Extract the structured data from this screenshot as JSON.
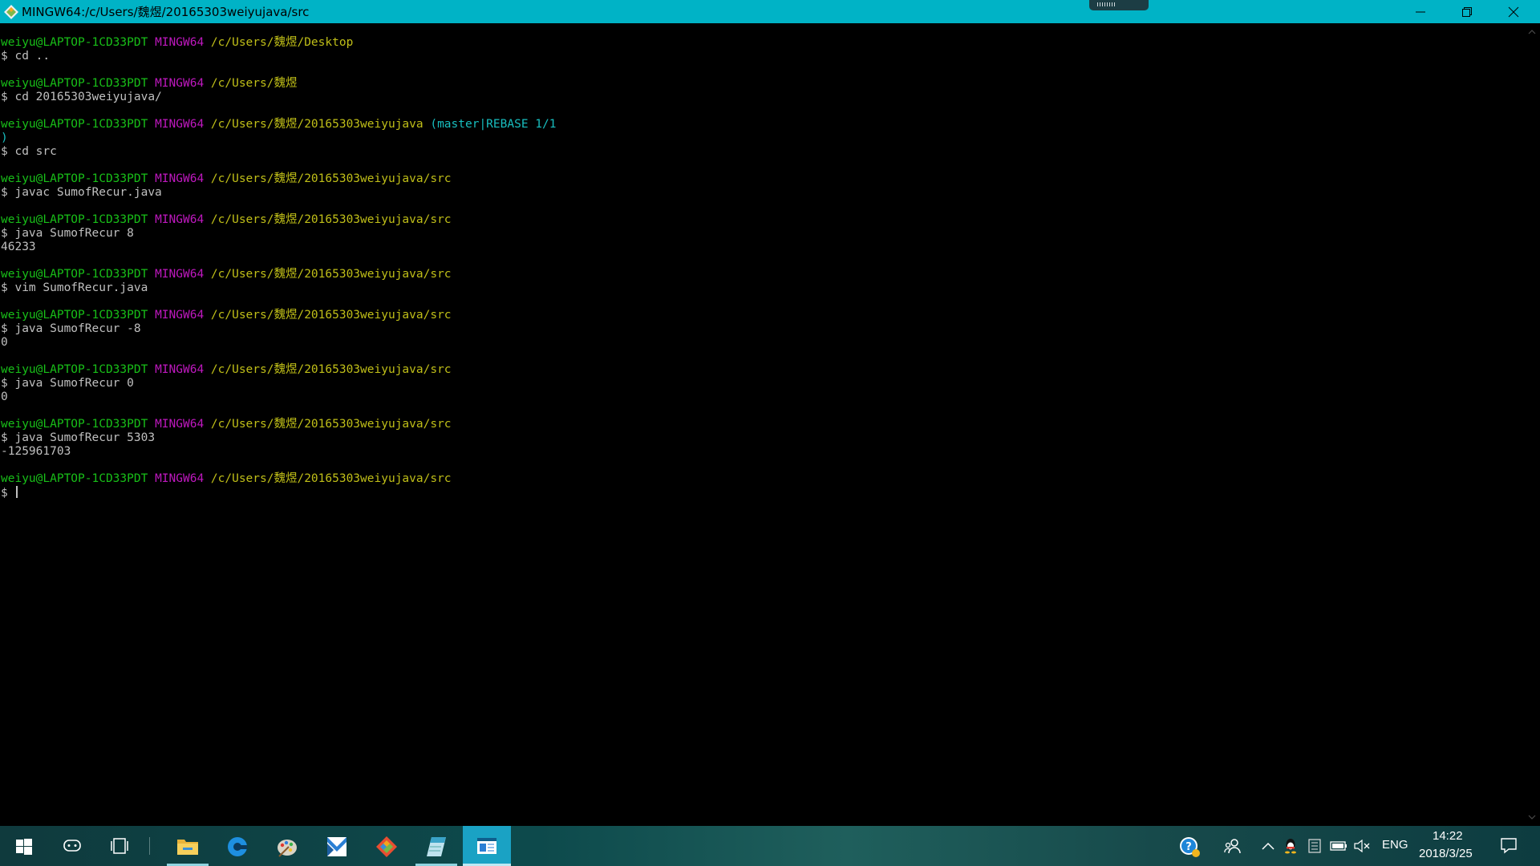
{
  "window": {
    "title": "MINGW64:/c/Users/魏煜/20165303weiyujava/src",
    "app_icon": "git-bash-icon",
    "controls": [
      "minimize-icon",
      "restore-icon",
      "close-icon"
    ]
  },
  "terminal": {
    "colors": {
      "user_host": "#18bf18",
      "msystem": "#bf18bf",
      "path": "#c0bf18",
      "git_branch": "#18bfc0",
      "text": "#c0c0c0"
    },
    "lines": [
      {
        "user": "weiyu@LAPTOP-1CD33PDT",
        "msys": "MINGW64",
        "path": "/c/Users/魏煜/Desktop"
      },
      {
        "cmd": "$ cd .."
      },
      {},
      {
        "user": "weiyu@LAPTOP-1CD33PDT",
        "msys": "MINGW64",
        "path": "/c/Users/魏煜"
      },
      {
        "cmd": "$ cd 20165303weiyujava/"
      },
      {},
      {
        "user": "weiyu@LAPTOP-1CD33PDT",
        "msys": "MINGW64",
        "path": "/c/Users/魏煜/20165303weiyujava",
        "branch": "(master|REBASE 1/1"
      },
      {
        "branch": ")"
      },
      {
        "cmd": "$ cd src"
      },
      {},
      {
        "user": "weiyu@LAPTOP-1CD33PDT",
        "msys": "MINGW64",
        "path": "/c/Users/魏煜/20165303weiyujava/src"
      },
      {
        "cmd": "$ javac SumofRecur.java"
      },
      {},
      {
        "user": "weiyu@LAPTOP-1CD33PDT",
        "msys": "MINGW64",
        "path": "/c/Users/魏煜/20165303weiyujava/src"
      },
      {
        "cmd": "$ java SumofRecur 8"
      },
      {
        "out": "46233"
      },
      {},
      {
        "user": "weiyu@LAPTOP-1CD33PDT",
        "msys": "MINGW64",
        "path": "/c/Users/魏煜/20165303weiyujava/src"
      },
      {
        "cmd": "$ vim SumofRecur.java"
      },
      {},
      {
        "user": "weiyu@LAPTOP-1CD33PDT",
        "msys": "MINGW64",
        "path": "/c/Users/魏煜/20165303weiyujava/src"
      },
      {
        "cmd": "$ java SumofRecur -8"
      },
      {
        "out": "0"
      },
      {},
      {
        "user": "weiyu@LAPTOP-1CD33PDT",
        "msys": "MINGW64",
        "path": "/c/Users/魏煜/20165303weiyujava/src"
      },
      {
        "cmd": "$ java SumofRecur 0"
      },
      {
        "out": "0"
      },
      {},
      {
        "user": "weiyu@LAPTOP-1CD33PDT",
        "msys": "MINGW64",
        "path": "/c/Users/魏煜/20165303weiyujava/src"
      },
      {
        "cmd": "$ java SumofRecur 5303"
      },
      {
        "out": "-125961703"
      },
      {},
      {
        "user": "weiyu@LAPTOP-1CD33PDT",
        "msys": "MINGW64",
        "path": "/c/Users/魏煜/20165303weiyujava/src"
      },
      {
        "cmd": "$ ",
        "cursor": true
      }
    ]
  },
  "taskbar": {
    "pinned": [
      "start-windows-icon",
      "cortana-icon",
      "task-view-icon",
      "file-explorer-icon",
      "edge-icon",
      "paint-icon",
      "mail-icon",
      "git-gui-icon",
      "notepad-icon",
      "git-bash-taskbar-icon"
    ],
    "tray_icons": [
      "help-icon",
      "people-icon",
      "chevron-up-icon",
      "qq-icon",
      "input-method-icon",
      "battery-icon",
      "volume-muted-icon"
    ],
    "language": "ENG",
    "time": "14:22",
    "date": "2018/3/25",
    "notifications_icon": "action-center-icon"
  }
}
